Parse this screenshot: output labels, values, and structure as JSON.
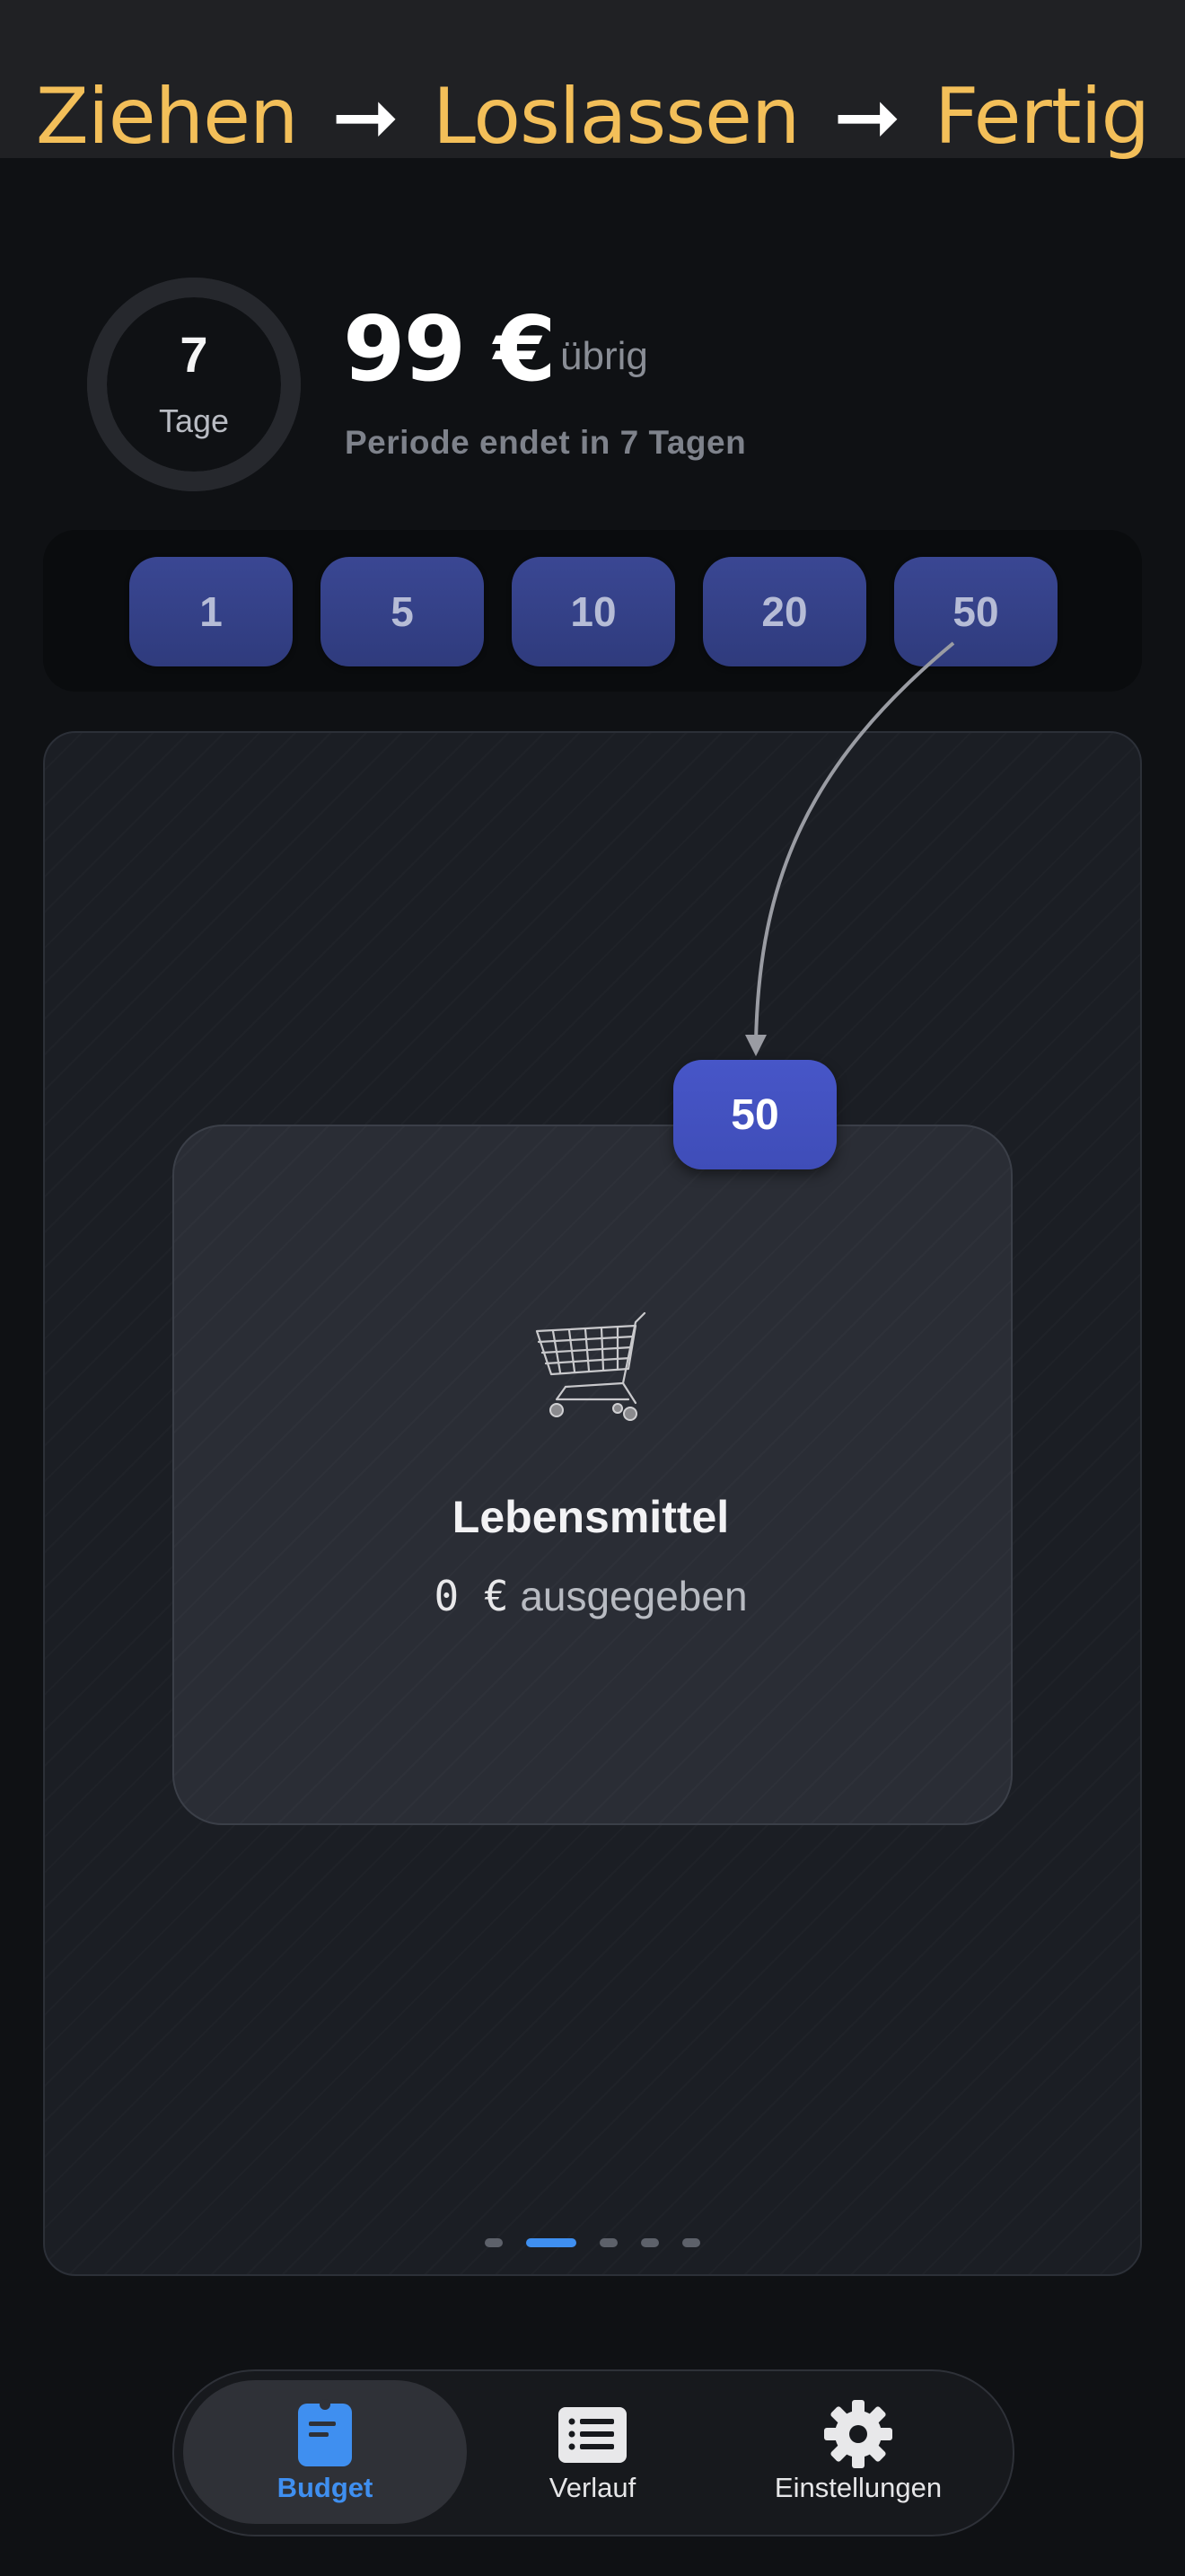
{
  "banner": {
    "step1": "Ziehen",
    "arrow1": "➞",
    "step2": "Loslassen",
    "arrow2": "➞",
    "step3": "Fertig"
  },
  "period": {
    "days_value": "7",
    "days_unit": "Tage",
    "days_remaining_fraction": 1.0,
    "amount": "99 €",
    "amount_suffix": "übrig",
    "subtitle": "Periode endet in 7 Tagen"
  },
  "chips": [
    {
      "label": "1"
    },
    {
      "label": "5"
    },
    {
      "label": "10"
    },
    {
      "label": "20"
    },
    {
      "label": "50"
    }
  ],
  "dragging_chip": {
    "label": "50"
  },
  "category": {
    "icon": "shopping-cart-icon",
    "name": "Lebensmittel",
    "spent_value": "0 €",
    "spent_label": "ausgegeben"
  },
  "pager": {
    "count": 5,
    "active_index": 1
  },
  "tabs": [
    {
      "label": "Budget",
      "icon": "budget-icon",
      "active": true
    },
    {
      "label": "Verlauf",
      "icon": "history-list-icon",
      "active": false
    },
    {
      "label": "Einstellungen",
      "icon": "gear-icon",
      "active": false
    }
  ],
  "colors": {
    "accent": "#3f8ff0",
    "banner_text": "#f3bf59",
    "chip": "#3a4793",
    "background": "#0f1114"
  }
}
